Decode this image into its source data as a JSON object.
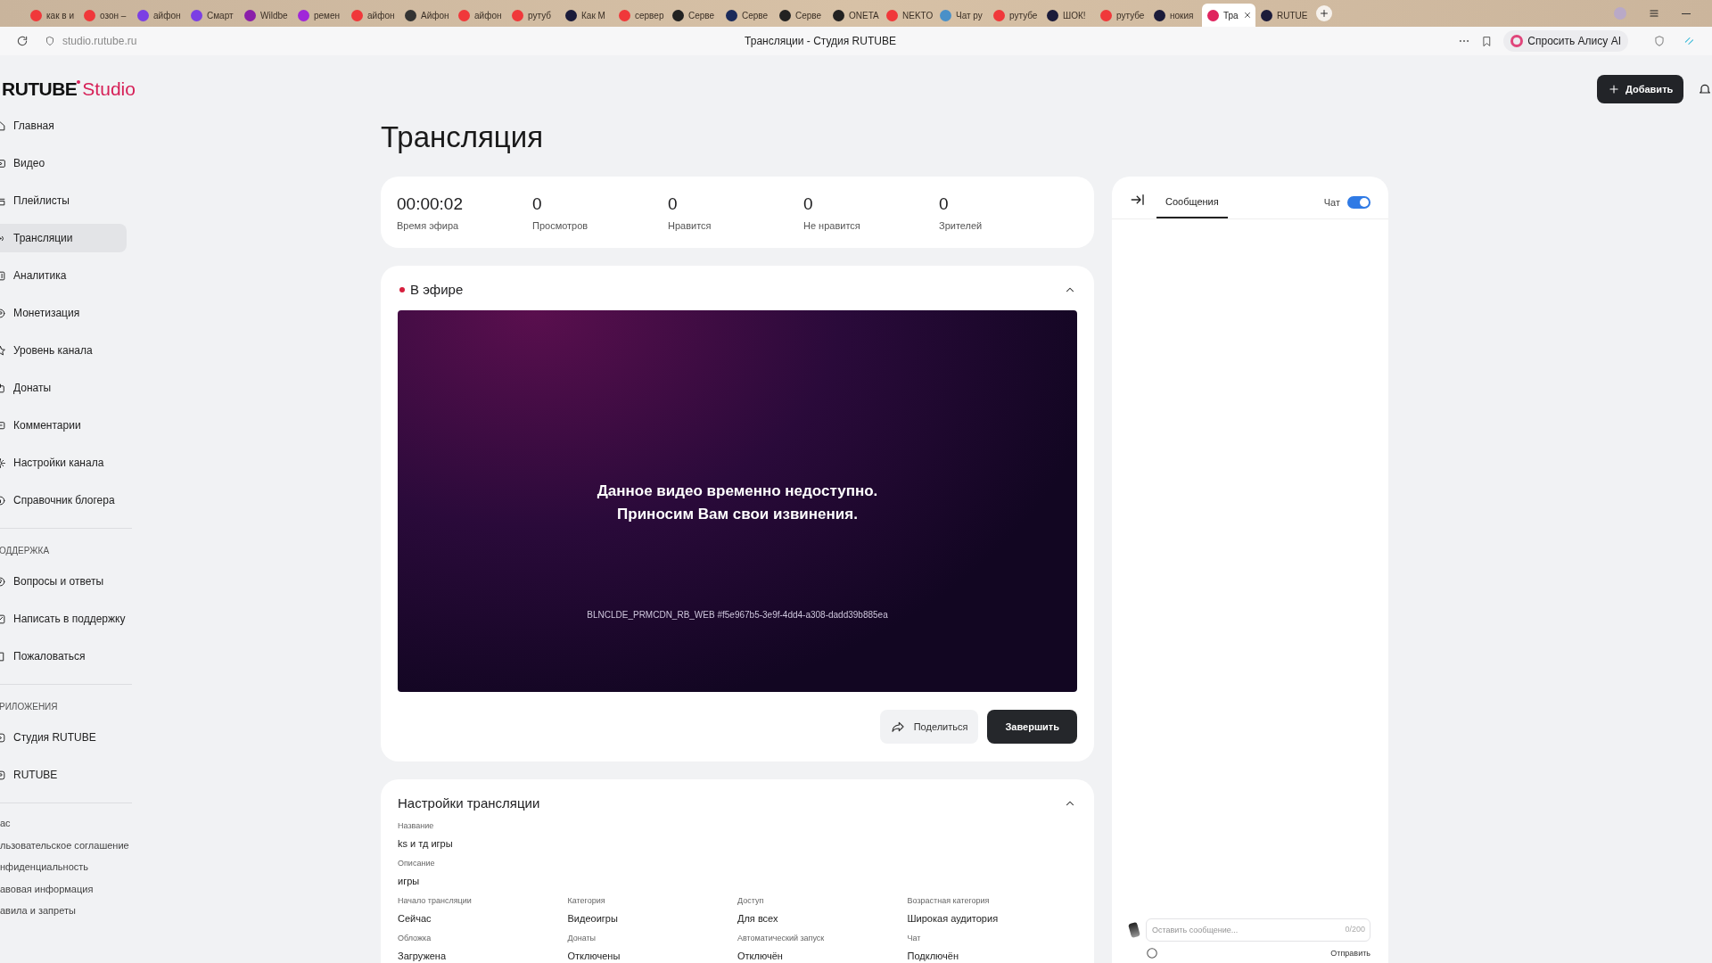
{
  "browser": {
    "tabs": [
      {
        "label": "как в и",
        "color": "#f0383a",
        "selected": false
      },
      {
        "label": "озон –",
        "color": "#f0383a",
        "selected": false
      },
      {
        "label": "айфон",
        "color": "#7b3fe4",
        "selected": false
      },
      {
        "label": "Смарт",
        "color": "#7b3fe4",
        "selected": false
      },
      {
        "label": "Wildbe",
        "color": "#8b1fa9",
        "selected": false
      },
      {
        "label": "ремен",
        "color": "#a026d9",
        "selected": false
      },
      {
        "label": "айфон",
        "color": "#f0383a",
        "selected": false
      },
      {
        "label": "Айфон",
        "color": "#333333",
        "selected": false
      },
      {
        "label": "айфон",
        "color": "#f0383a",
        "selected": false
      },
      {
        "label": "рутуб",
        "color": "#f0383a",
        "selected": false
      },
      {
        "label": "Как М",
        "color": "#1b1b3a",
        "selected": false
      },
      {
        "label": "сервер",
        "color": "#f0383a",
        "selected": false
      },
      {
        "label": "Серве",
        "color": "#222222",
        "selected": false
      },
      {
        "label": "Серве",
        "color": "#1a2a5a",
        "selected": false
      },
      {
        "label": "Серве",
        "color": "#222222",
        "selected": false
      },
      {
        "label": "ONETA",
        "color": "#222222",
        "selected": false
      },
      {
        "label": "NEKTO",
        "color": "#f0383a",
        "selected": false
      },
      {
        "label": "Чат ру",
        "color": "#4a90c8",
        "selected": false
      },
      {
        "label": "рутубе",
        "color": "#f0383a",
        "selected": false
      },
      {
        "label": "ШОК!",
        "color": "#1b1b3a",
        "selected": false
      },
      {
        "label": "рутубе",
        "color": "#f0383a",
        "selected": false
      },
      {
        "label": "нокия",
        "color": "#1b1b3a",
        "selected": false
      },
      {
        "label": "Тра",
        "color": "#e0245e",
        "selected": true
      },
      {
        "label": "RUTUE",
        "color": "#1b1b3a",
        "selected": false
      }
    ],
    "url": "studio.rutube.ru",
    "page_title": "Трансляции - Студия RUTUBE",
    "alice_button": "Спросить Алису AI"
  },
  "logo": {
    "brand": "RUTUBE",
    "product": "Studio"
  },
  "add_button": "Добавить",
  "sidebar": {
    "sections": [
      {
        "items": [
          {
            "label": "Главная",
            "selected": false
          },
          {
            "label": "Видео",
            "selected": false
          },
          {
            "label": "Плейлисты",
            "selected": false
          },
          {
            "label": "Трансляции",
            "selected": true
          },
          {
            "label": "Аналитика",
            "selected": false
          },
          {
            "label": "Монетизация",
            "selected": false
          },
          {
            "label": "Уровень канала",
            "selected": false
          },
          {
            "label": "Донаты",
            "selected": false
          },
          {
            "label": "Комментарии",
            "selected": false
          },
          {
            "label": "Настройки канала",
            "selected": false
          },
          {
            "label": "Справочник блогера",
            "selected": false
          }
        ]
      },
      {
        "heading": "ОДДЕРЖКА",
        "items": [
          {
            "label": "Вопросы и ответы",
            "selected": false
          },
          {
            "label": "Написать в поддержку",
            "selected": false
          },
          {
            "label": "Пожаловаться",
            "selected": false
          }
        ]
      },
      {
        "heading": "РИЛОЖЕНИЯ",
        "items": [
          {
            "label": "Студия RUTUBE",
            "selected": false
          },
          {
            "label": "RUTUBE",
            "selected": false
          }
        ]
      }
    ],
    "footer_links": [
      "ас",
      "льзовательское соглашение",
      "нфиденциальность",
      "авовая информация",
      "авила и запреты"
    ]
  },
  "page_title": "Трансляция",
  "stats": [
    {
      "value": "00:00:02",
      "label": "Время эфира"
    },
    {
      "value": "0",
      "label": "Просмотров"
    },
    {
      "value": "0",
      "label": "Нравится"
    },
    {
      "value": "0",
      "label": "Не нравится"
    },
    {
      "value": "0",
      "label": "Зрителей"
    }
  ],
  "live": {
    "title": "В эфире",
    "expanded": true,
    "player": {
      "message": [
        "Данное видео временно недоступно.",
        "Приносим Вам свои извинения."
      ],
      "code": "BLNCLDE_PRMCDN_RB_WEB #f5e967b5-3e9f-4dd4-a308-dadd39b885ea"
    },
    "share_button": "Поделиться",
    "end_button": "Завершить"
  },
  "settings": {
    "title": "Настройки трансляции",
    "expanded": true,
    "fields": [
      {
        "label": "Название",
        "value": "ks и тд игры",
        "kind": "wide"
      },
      {
        "label": "Описание",
        "value": "игры",
        "kind": "wide"
      },
      {
        "label": "Начало трансляции",
        "value": "Сейчас",
        "kind": "grid"
      },
      {
        "label": "Категория",
        "value": "Видеоигры",
        "kind": "grid"
      },
      {
        "label": "Доступ",
        "value": "Для всех",
        "kind": "grid"
      },
      {
        "label": "Возрастная категория",
        "value": "Широкая аудитория",
        "kind": "grid"
      },
      {
        "label": "Обложка",
        "value": "Загружена",
        "kind": "grid"
      },
      {
        "label": "Донаты",
        "value": "Отключены",
        "kind": "grid"
      },
      {
        "label": "Автоматический запуск",
        "value": "Отключён",
        "kind": "grid"
      },
      {
        "label": "Чат",
        "value": "Подключён",
        "kind": "grid"
      }
    ]
  },
  "chat": {
    "tabs": [
      {
        "label": "Сообщения",
        "selected": true
      }
    ],
    "toggle_label": "Чат",
    "chat_on": true,
    "input": {
      "placeholder": "Оставить сообщение...",
      "counter": "0/200"
    },
    "send_button": "Отправить"
  }
}
